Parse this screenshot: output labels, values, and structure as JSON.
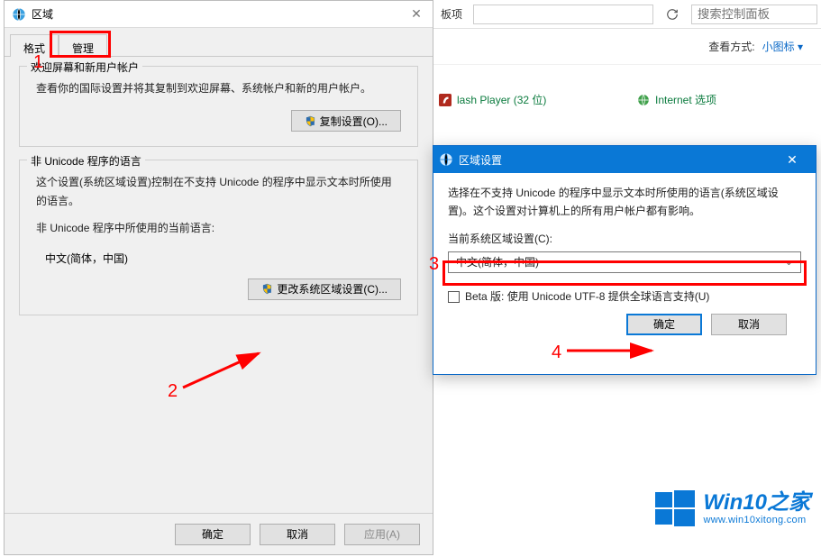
{
  "bg": {
    "title_frag": "板项",
    "refresh_icon": "refresh",
    "search_placeholder": "搜索控制面板",
    "view_label": "查看方式:",
    "view_mode": "小图标 ▾",
    "item1": "lash Player (32 位)",
    "item2": "Internet 选项"
  },
  "dlg1": {
    "title": "区域",
    "tabs": {
      "format": "格式",
      "admin": "管理"
    },
    "group1": {
      "title": "欢迎屏幕和新用户帐户",
      "text": "查看你的国际设置并将其复制到欢迎屏幕、系统帐户和新的用户帐户。",
      "btn": "复制设置(O)..."
    },
    "group2": {
      "title": "非 Unicode 程序的语言",
      "text": "这个设置(系统区域设置)控制在不支持 Unicode 的程序中显示文本时所使用的语言。",
      "current_label": "非 Unicode 程序中所使用的当前语言:",
      "current_value": "中文(简体，中国)",
      "btn": "更改系统区域设置(C)..."
    },
    "footer": {
      "ok": "确定",
      "cancel": "取消",
      "apply": "应用(A)"
    }
  },
  "dlg2": {
    "title": "区域设置",
    "desc": "选择在不支持 Unicode 的程序中显示文本时所使用的语言(系统区域设置)。这个设置对计算机上的所有用户帐户都有影响。",
    "label": "当前系统区域设置(C):",
    "select_value": "中文(简体，中国)",
    "beta": "Beta 版: 使用 Unicode UTF-8 提供全球语言支持(U)",
    "ok": "确定",
    "cancel": "取消"
  },
  "anno": {
    "n1": "1",
    "n2": "2",
    "n3": "3",
    "n4": "4"
  },
  "watermark": {
    "brand": "Win10",
    "brand_zh": "之家",
    "url": "www.win10xitong.com"
  }
}
